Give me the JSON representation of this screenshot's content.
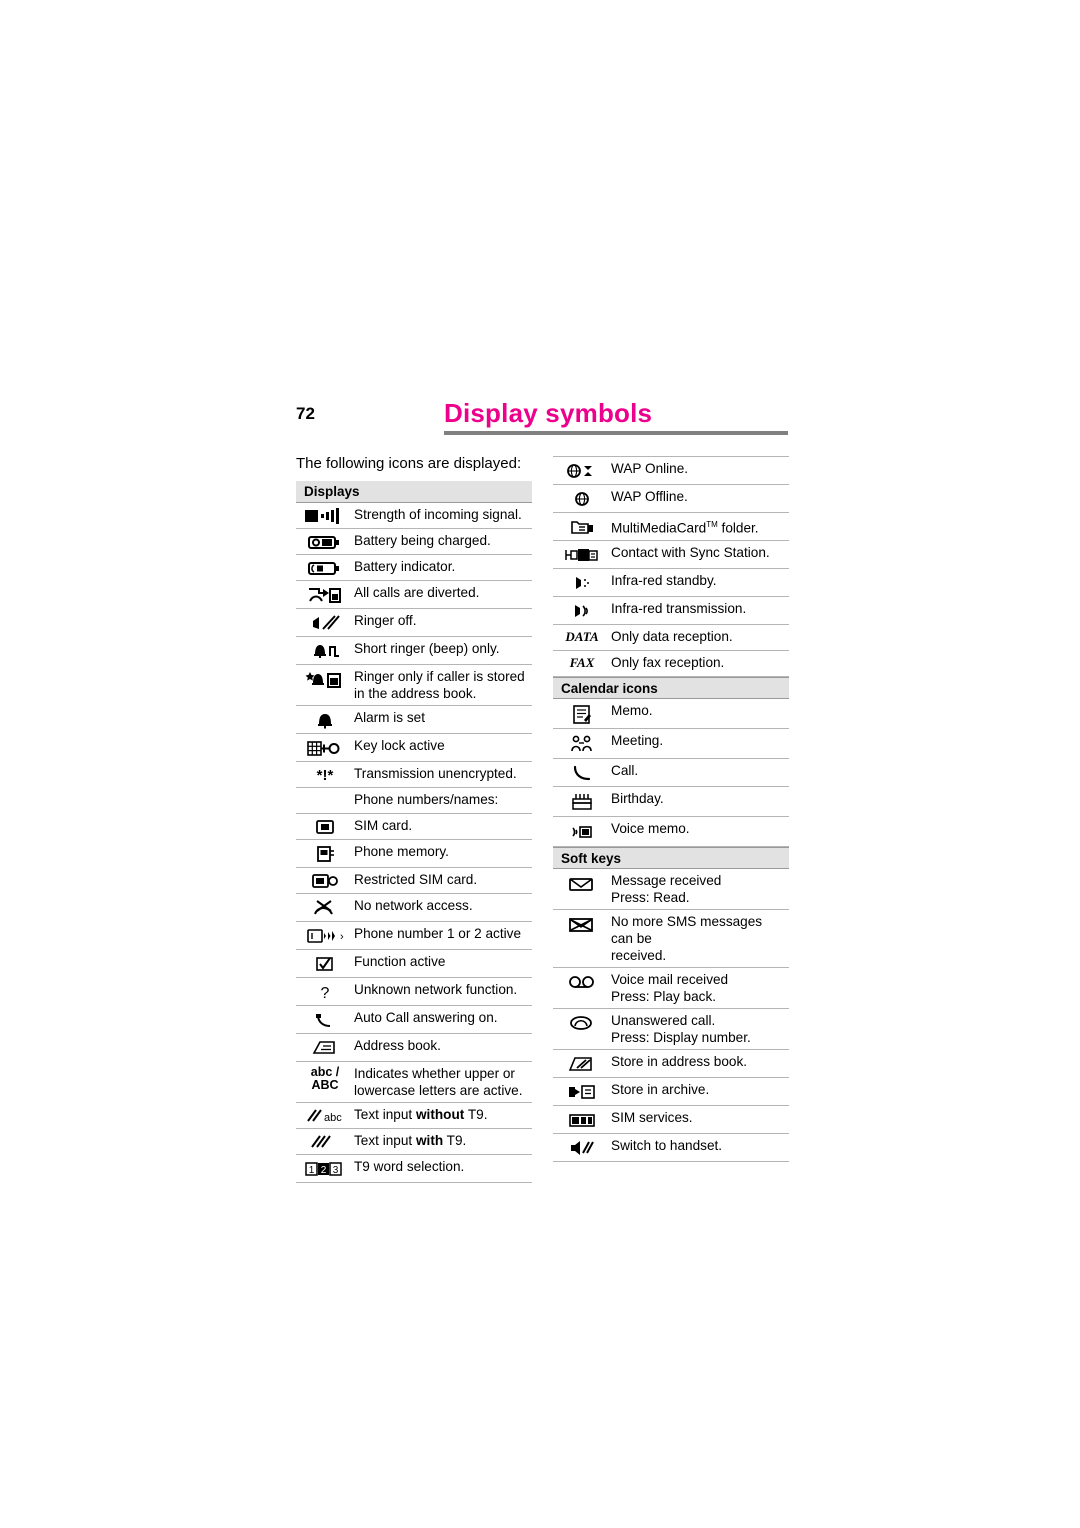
{
  "header": {
    "page_number": "72",
    "title": "Display symbols",
    "accent_color": "#ec008c",
    "rule_color": "#808080"
  },
  "intro": "The following icons are displayed:",
  "sections": [
    {
      "id": "displays",
      "heading": "Displays",
      "column": "left",
      "rows": [
        {
          "icon": "signal-strength-icon",
          "label": "Strength of incoming signal."
        },
        {
          "icon": "battery-charging-icon",
          "label": "Battery being charged."
        },
        {
          "icon": "battery-level-icon",
          "label": "Battery indicator."
        },
        {
          "icon": "call-divert-icon",
          "label": "All calls are diverted."
        },
        {
          "icon": "ringer-off-icon",
          "label": "Ringer off."
        },
        {
          "icon": "short-beep-ringer-icon",
          "label": "Short ringer (beep) only."
        },
        {
          "icon": "ringer-known-caller-icon",
          "label": "Ringer only if caller is stored in the address book."
        },
        {
          "icon": "alarm-bell-icon",
          "label": "Alarm is set"
        },
        {
          "icon": "keylock-icon",
          "label": "Key lock active"
        },
        {
          "icon": "unencrypted-icon",
          "label": "Transmission unencrypted."
        },
        {
          "icon": "none",
          "label": "Phone numbers/names:"
        },
        {
          "icon": "sim-card-icon",
          "label": "SIM card."
        },
        {
          "icon": "phone-memory-icon",
          "label": "Phone memory."
        },
        {
          "icon": "restricted-sim-icon",
          "label": "Restricted SIM card."
        },
        {
          "icon": "no-network-icon",
          "label": "No network access."
        },
        {
          "icon": "phone-line-icon",
          "label": "Phone number 1 or 2 active"
        },
        {
          "icon": "function-active-icon",
          "label": "Function active"
        },
        {
          "icon": "question-mark-icon",
          "label": "Unknown network function."
        },
        {
          "icon": "auto-answer-icon",
          "label": "Auto Call answering on."
        },
        {
          "icon": "address-book-icon",
          "label": "Address book."
        },
        {
          "icon": "abc-case-icon",
          "label": "Indicates whether upper or lowercase letters are active."
        },
        {
          "icon": "text-input-no-t9-icon",
          "label_parts": [
            "Text input ",
            "without",
            " T9."
          ]
        },
        {
          "icon": "text-input-t9-icon",
          "label_parts": [
            "Text input ",
            "with",
            " T9."
          ]
        },
        {
          "icon": "t9-word-selection-icon",
          "label": "T9 word selection."
        }
      ]
    },
    {
      "id": "displays_right",
      "heading": "",
      "column": "right",
      "rows": [
        {
          "icon": "wap-online-icon",
          "label": "WAP Online."
        },
        {
          "icon": "wap-offline-icon",
          "label": "WAP Offline."
        },
        {
          "icon": "multimediacard-folder-icon",
          "label_parts_tm": [
            "MultiMediaCard",
            "TM",
            " folder."
          ]
        },
        {
          "icon": "sync-station-icon",
          "label": "Contact with Sync Station."
        },
        {
          "icon": "infrared-standby-icon",
          "label": "Infra-red standby."
        },
        {
          "icon": "infrared-transmission-icon",
          "label": "Infra-red transmission."
        },
        {
          "icon": "data-text-icon",
          "icon_text": "DATA",
          "label": "Only data reception."
        },
        {
          "icon": "fax-text-icon",
          "icon_text": "FAX",
          "label": "Only fax reception."
        }
      ]
    },
    {
      "id": "calendar",
      "heading": "Calendar icons",
      "column": "right",
      "rows": [
        {
          "icon": "memo-icon",
          "label": "Memo."
        },
        {
          "icon": "meeting-icon",
          "label": "Meeting."
        },
        {
          "icon": "call-icon",
          "label": "Call."
        },
        {
          "icon": "birthday-cake-icon",
          "label": "Birthday."
        },
        {
          "icon": "voice-memo-icon",
          "label": "Voice memo."
        }
      ]
    },
    {
      "id": "softkeys",
      "heading": "Soft keys",
      "column": "right",
      "rows": [
        {
          "icon": "envelope-icon",
          "label": "Message received Press: Read.",
          "line1": "Message received",
          "line2": "Press: Read."
        },
        {
          "icon": "sms-full-icon",
          "line1": "No more SMS messages can be",
          "line2": "received."
        },
        {
          "icon": "voicemail-icon",
          "line1": "Voice mail received",
          "line2": "Press: Play back."
        },
        {
          "icon": "missed-call-icon",
          "line1": "Unanswered call.",
          "line2": "Press: Display number."
        },
        {
          "icon": "store-address-book-icon",
          "line1": "Store in address book."
        },
        {
          "icon": "store-archive-icon",
          "line1": "Store in archive."
        },
        {
          "icon": "sim-services-icon",
          "line1": "SIM services."
        },
        {
          "icon": "switch-handset-icon",
          "line1": "Switch to handset."
        }
      ]
    }
  ]
}
